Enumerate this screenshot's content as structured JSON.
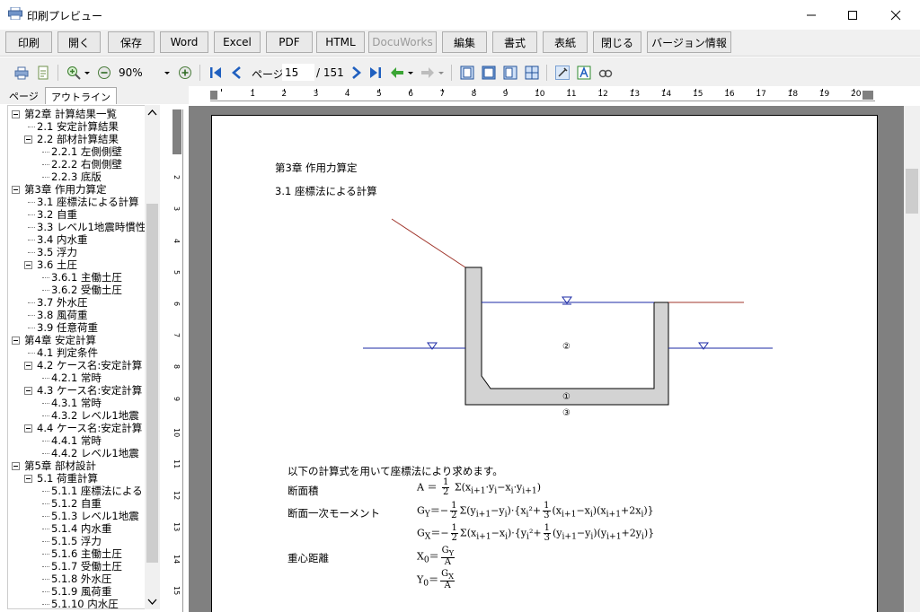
{
  "window": {
    "title": "印刷プレビュー"
  },
  "buttons": [
    {
      "label": "印刷"
    },
    {
      "label": "開く"
    },
    {
      "label": "保存"
    },
    {
      "label": "Word"
    },
    {
      "label": "Excel"
    },
    {
      "label": "PDF"
    },
    {
      "label": "HTML"
    },
    {
      "label": "DocuWorks",
      "disabled": true
    },
    {
      "label": "編集"
    },
    {
      "label": "書式"
    },
    {
      "label": "表紙"
    },
    {
      "label": "閉じる"
    },
    {
      "label": "バージョン情報"
    }
  ],
  "toolbar": {
    "zoom": "90%",
    "page_label": "ページ",
    "page_current": "15",
    "page_total": "/ 151"
  },
  "tabs": [
    {
      "label": "ページ"
    },
    {
      "label": "アウトライン"
    }
  ],
  "outline": [
    {
      "label": "第2章 計算結果一覧",
      "level": 0,
      "box": true
    },
    {
      "label": "2.1 安定計算結果",
      "level": 1
    },
    {
      "label": "2.2 部材計算結果",
      "level": 1,
      "box": true
    },
    {
      "label": "2.2.1 左側側壁",
      "level": 2
    },
    {
      "label": "2.2.2 右側側壁",
      "level": 2
    },
    {
      "label": "2.2.3 底版",
      "level": 2
    },
    {
      "label": "第3章 作用力算定",
      "level": 0,
      "box": true
    },
    {
      "label": "3.1 座標法による計算",
      "level": 1
    },
    {
      "label": "3.2 自重",
      "level": 1
    },
    {
      "label": "3.3 レベル1地震時慣性",
      "level": 1
    },
    {
      "label": "3.4 内水重",
      "level": 1
    },
    {
      "label": "3.5 浮力",
      "level": 1
    },
    {
      "label": "3.6 土圧",
      "level": 1,
      "box": true
    },
    {
      "label": "3.6.1 主働土圧",
      "level": 2
    },
    {
      "label": "3.6.2 受働土圧",
      "level": 2
    },
    {
      "label": "3.7 外水圧",
      "level": 1
    },
    {
      "label": "3.8 風荷重",
      "level": 1
    },
    {
      "label": "3.9 任意荷重",
      "level": 1
    },
    {
      "label": "第4章 安定計算",
      "level": 0,
      "box": true
    },
    {
      "label": "4.1 判定条件",
      "level": 1
    },
    {
      "label": "4.2 ケース名:安定計算",
      "level": 1,
      "box": true
    },
    {
      "label": "4.2.1 常時",
      "level": 2
    },
    {
      "label": "4.3 ケース名:安定計算",
      "level": 1,
      "box": true
    },
    {
      "label": "4.3.1 常時",
      "level": 2
    },
    {
      "label": "4.3.2 レベル1地震",
      "level": 2
    },
    {
      "label": "4.4 ケース名:安定計算",
      "level": 1,
      "box": true
    },
    {
      "label": "4.4.1 常時",
      "level": 2
    },
    {
      "label": "4.4.2 レベル1地震",
      "level": 2
    },
    {
      "label": "第5章 部材設計",
      "level": 0,
      "box": true
    },
    {
      "label": "5.1 荷重計算",
      "level": 1,
      "box": true
    },
    {
      "label": "5.1.1 座標法による",
      "level": 2
    },
    {
      "label": "5.1.2 自重",
      "level": 2
    },
    {
      "label": "5.1.3 レベル1地震",
      "level": 2
    },
    {
      "label": "5.1.4 内水重",
      "level": 2
    },
    {
      "label": "5.1.5 浮力",
      "level": 2
    },
    {
      "label": "5.1.6 主働土圧",
      "level": 2
    },
    {
      "label": "5.1.7 受働土圧",
      "level": 2
    },
    {
      "label": "5.1.8 外水圧",
      "level": 2
    },
    {
      "label": "5.1.9 風荷重",
      "level": 2
    },
    {
      "label": "5.1.10 内水圧",
      "level": 2
    }
  ],
  "ruler_h": [
    "1",
    "2",
    "3",
    "4",
    "5",
    "6",
    "7",
    "8",
    "9",
    "10",
    "11",
    "12",
    "13",
    "14",
    "15",
    "16",
    "17",
    "18",
    "19",
    "20"
  ],
  "ruler_v": [
    "1",
    "2",
    "3",
    "4",
    "5",
    "6",
    "7",
    "8",
    "9",
    "10",
    "11",
    "12",
    "13",
    "14",
    "15",
    "16"
  ],
  "document": {
    "chapter": "第3章 作用力算定",
    "section": "3.1 座標法による計算",
    "diagram_labels": {
      "region2": "②",
      "region1": "①",
      "region3": "③"
    },
    "intro": "以下の計算式を用いて座標法により求めます。",
    "area_label": "断面積",
    "moment_label": "断面一次モーメント",
    "centroid_label": "重心距離",
    "formula_A_lhs": "A ＝",
    "formula_A_rhs": "Σ(x",
    "formula_Gy_lhs": "G",
    "formula_Gx_lhs": "G",
    "formula_X0_lhs": "X",
    "formula_Y0_lhs": "Y"
  }
}
